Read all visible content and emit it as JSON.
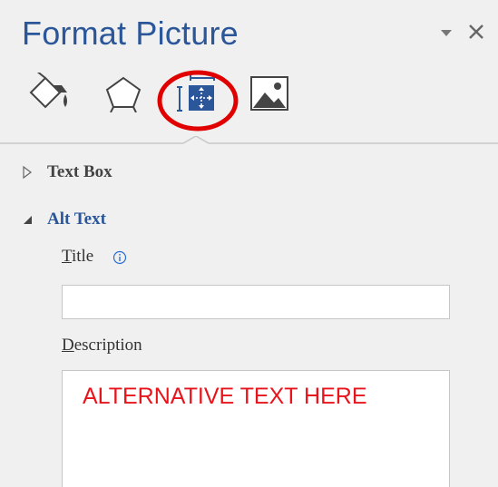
{
  "pane": {
    "title": "Format Picture"
  },
  "window_controls": {
    "pin_icon": "task-pane-options-icon",
    "close_icon": "close-icon"
  },
  "tabs": [
    {
      "id": "fill-line",
      "icon": "paint-bucket-icon"
    },
    {
      "id": "effects",
      "icon": "pentagon-icon"
    },
    {
      "id": "size-properties",
      "icon": "size-properties-icon",
      "selected": true,
      "highlighted": true
    },
    {
      "id": "picture",
      "icon": "picture-icon"
    }
  ],
  "sections": {
    "text_box": {
      "label": "Text Box",
      "expanded": false
    },
    "alt_text": {
      "label": "Alt Text",
      "expanded": true,
      "title_label_first": "T",
      "title_label_rest": "itle",
      "title_value": "",
      "description_label_first": "D",
      "description_label_rest": "escription",
      "description_value": "ALTERNATIVE TEXT HERE"
    }
  },
  "colors": {
    "accent": "#2b579a",
    "header_text": "#444444",
    "highlight": "#e00000",
    "annotation": "#e8141c",
    "background": "#f0f0f0"
  }
}
